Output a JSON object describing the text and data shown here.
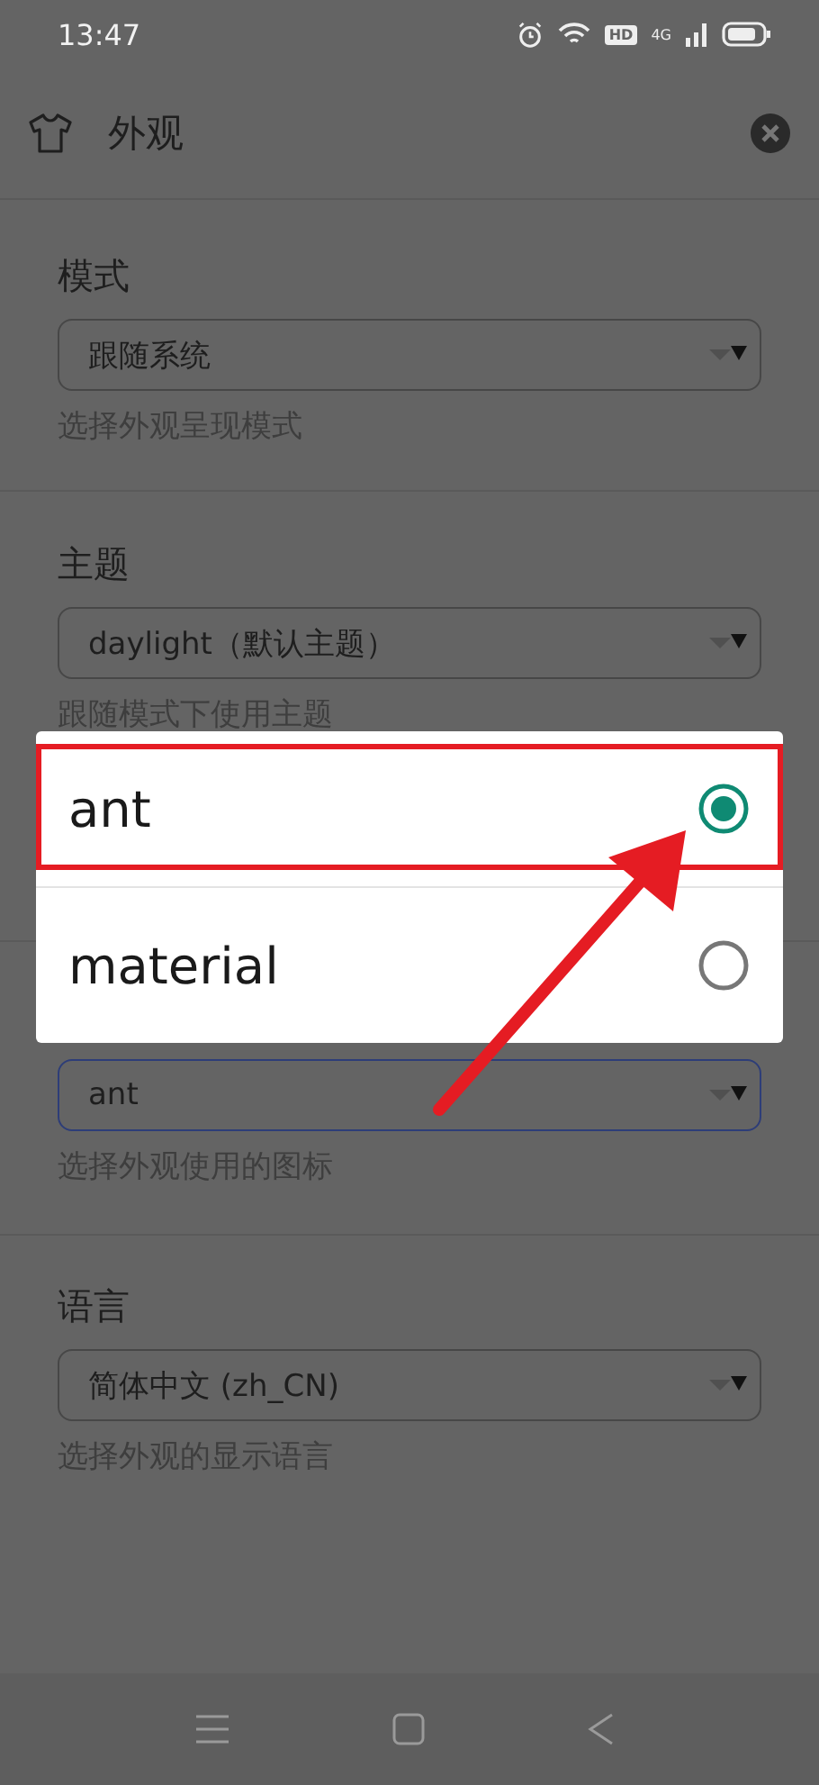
{
  "status_bar": {
    "time": "13:47",
    "hd_badge": "HD",
    "network": "4G"
  },
  "header": {
    "title": "外观"
  },
  "sections": [
    {
      "label": "模式",
      "select": {
        "value": "跟随系统",
        "focused": false
      },
      "hint": "选择外观呈现模式"
    },
    {
      "label": "主题",
      "select": {
        "value": "daylight（默认主题）",
        "focused": false
      },
      "hint": "跟随模式下使用主题"
    },
    {
      "select": {
        "value": "ant",
        "focused": true
      },
      "hint": "选择外观使用的图标"
    },
    {
      "label": "语言",
      "select": {
        "value": "简体中文 (zh_CN)",
        "focused": false
      },
      "hint": "选择外观的显示语言"
    }
  ],
  "dialog": {
    "options": [
      {
        "label": "ant",
        "selected": true,
        "annotated": true
      },
      {
        "label": "material",
        "selected": false,
        "annotated": false
      }
    ]
  }
}
